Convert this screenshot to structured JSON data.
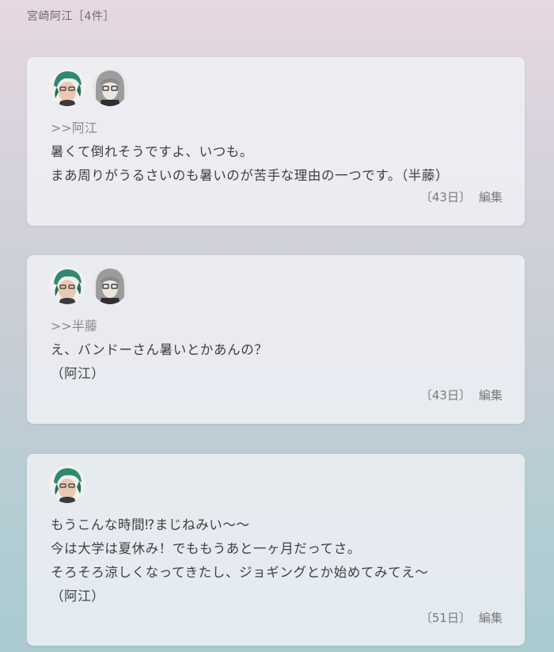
{
  "header": {
    "title": "宮崎阿江［4件］"
  },
  "posts": [
    {
      "avatars": [
        "green-hair-avatar-icon",
        "gray-hair-glasses-avatar-icon"
      ],
      "reply_to": ">>阿江",
      "lines": [
        "暑くて倒れそうですよ、いつも。",
        "まあ周りがうるさいのも暑いのが苦手な理由の一つです。（半藤）"
      ],
      "days": "〔43日〕",
      "edit_label": "編集"
    },
    {
      "avatars": [
        "green-hair-avatar-icon",
        "gray-hair-glasses-avatar-icon"
      ],
      "reply_to": ">>半藤",
      "lines": [
        "え、バンドーさん暑いとかあんの？",
        "（阿江）"
      ],
      "days": "〔43日〕",
      "edit_label": "編集"
    },
    {
      "avatars": [
        "green-hair-avatar-icon"
      ],
      "reply_to": "",
      "lines": [
        "もうこんな時間⁉まじねみい～～",
        "今は大学は夏休み！でももうあと一ヶ月だってさ。",
        "そろそろ涼しくなってきたし、ジョギングとか始めてみてえ～",
        "（阿江）"
      ],
      "days": "〔51日〕",
      "edit_label": "編集"
    }
  ]
}
